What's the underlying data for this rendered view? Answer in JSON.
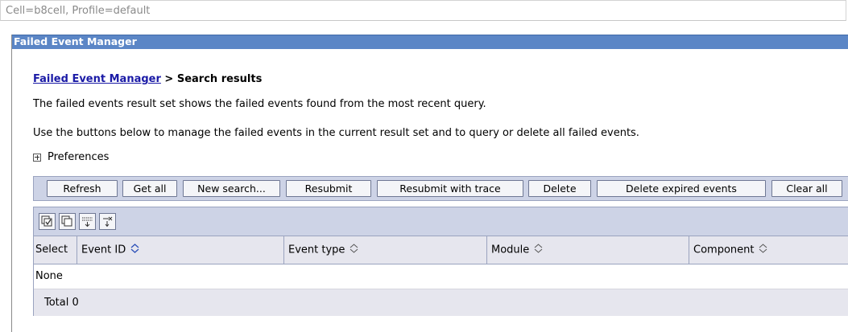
{
  "scope": "Cell=b8cell, Profile=default",
  "panel_title": "Failed Event Manager",
  "breadcrumb": {
    "link": "Failed Event Manager",
    "separator": " > ",
    "current": "Search results"
  },
  "description_1": "The failed events result set shows the failed events found from the most recent query.",
  "description_2": "Use the buttons below to manage the failed events in the current result set and to query or delete all failed events.",
  "preferences_label": "Preferences",
  "toolbar": {
    "buttons": [
      "Refresh",
      "Get all",
      "New search...",
      "Resubmit",
      "Resubmit with trace",
      "Delete",
      "Delete expired events",
      "Clear all"
    ]
  },
  "icon_toolbar": [
    "select-all-icon",
    "deselect-all-icon",
    "show-filter-icon",
    "clear-filter-icon"
  ],
  "table": {
    "columns": [
      "Select",
      "Event ID",
      "Event type",
      "Module",
      "Component"
    ],
    "sorted_column": "Event ID",
    "empty_text": "None",
    "total_label": "Total 0"
  },
  "colors": {
    "title_bar": "#5b86c6",
    "toolbar_bg": "#cdd3e6",
    "link": "#1a1aa6",
    "header_bg": "#e6e6ee"
  }
}
